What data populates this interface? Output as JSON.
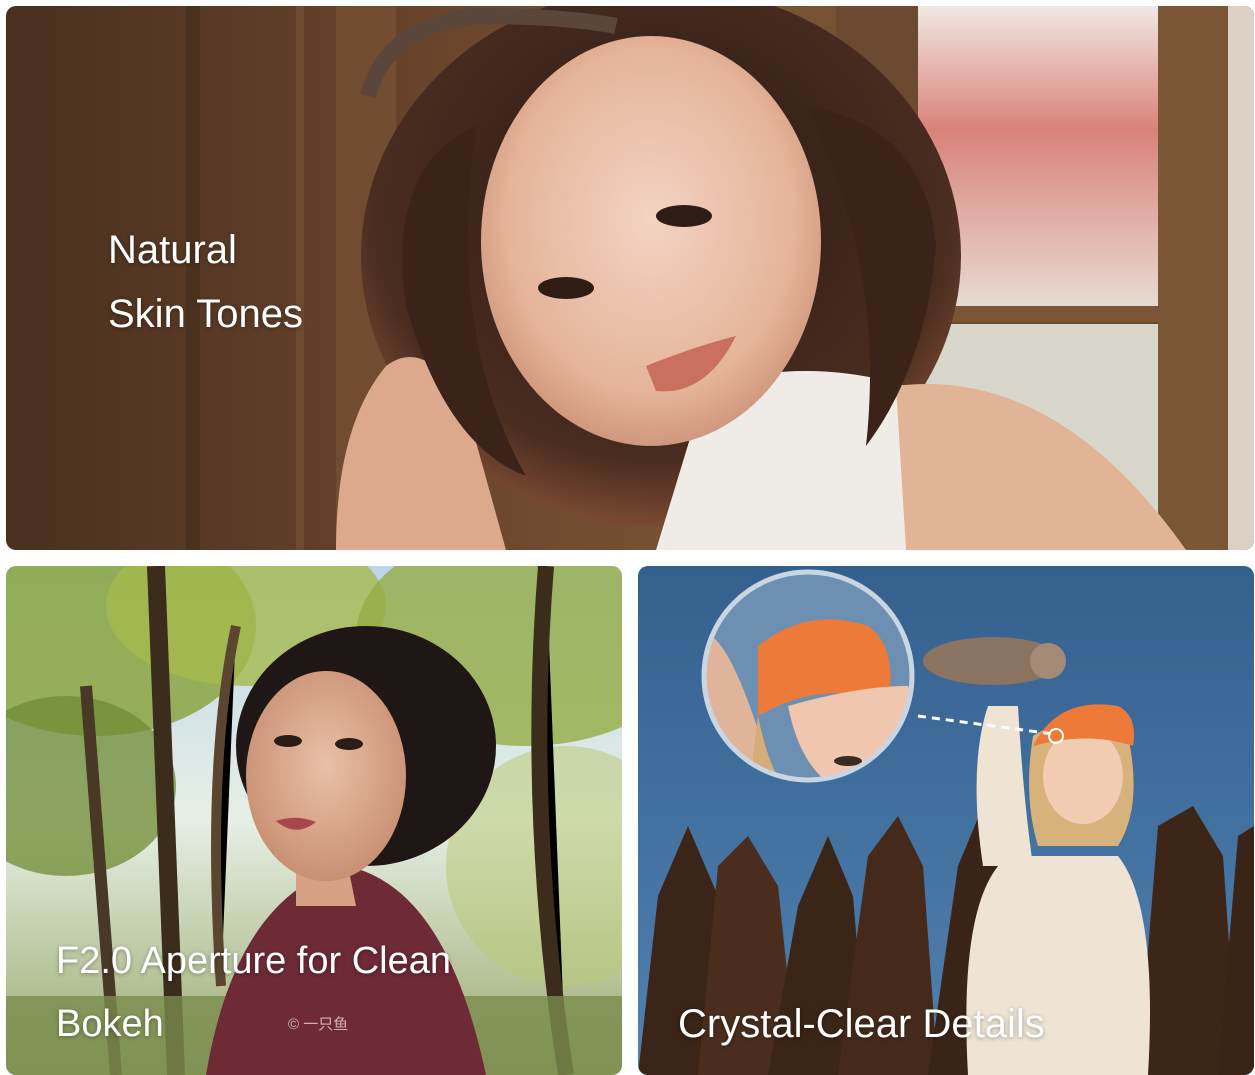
{
  "cards": [
    {
      "caption_line1": "Natural",
      "caption_line2": "Skin Tones"
    },
    {
      "caption": "F2.0 Aperture for Clean Bokeh",
      "watermark": "© 一只鱼"
    },
    {
      "caption": "Crystal-Clear Details"
    }
  ],
  "colors": {
    "wood_dark": "#5a3a26",
    "sky_blue": "#3d6d9b",
    "beret_orange": "#ee7a3a",
    "foliage_green": "#8aa540"
  }
}
